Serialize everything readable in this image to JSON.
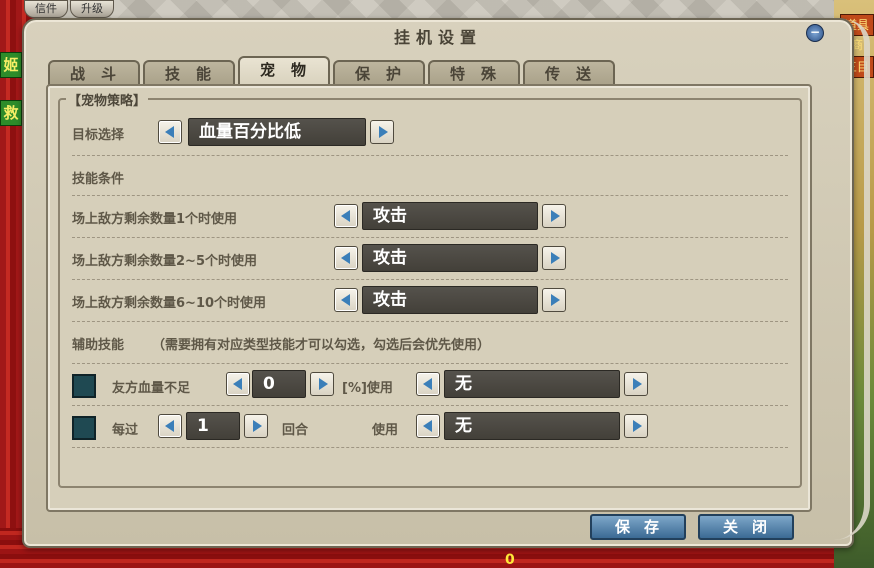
{
  "top_buttons": [
    "信件",
    "升级"
  ],
  "side_tags": [
    "姬",
    "救"
  ],
  "right_tags": [
    "道具商",
    "三目"
  ],
  "bottom_glyph": "0",
  "dialog": {
    "title": "挂机设置",
    "close_label": "−"
  },
  "tabs": [
    {
      "label": "战斗",
      "active": false
    },
    {
      "label": "技能",
      "active": false
    },
    {
      "label": "宠物",
      "active": true
    },
    {
      "label": "保护",
      "active": false
    },
    {
      "label": "特殊",
      "active": false
    },
    {
      "label": "传送",
      "active": false
    }
  ],
  "pet_strategy": {
    "legend": "【宠物策略】",
    "target_label": "目标选择",
    "target_value": "血量百分比低",
    "skill_conditions_label": "技能条件",
    "conditions": [
      {
        "label": "场上敌方剩余数量1个时使用",
        "value": "攻击"
      },
      {
        "label": "场上敌方剩余数量2~5个时使用",
        "value": "攻击"
      },
      {
        "label": "场上敌方剩余数量6~10个时使用",
        "value": "攻击"
      }
    ],
    "assist_label": "辅助技能",
    "assist_note": "（需要拥有对应类型技能才可以勾选，勾选后会优先使用）",
    "assist_hp": {
      "prefix": "友方血量不足",
      "amount": "0",
      "suffix": "[%]使用",
      "value": "无",
      "checked": false
    },
    "assist_round": {
      "prefix": "每过",
      "amount": "1",
      "unit": "回合",
      "use_label": "使用",
      "value": "无",
      "checked": false
    }
  },
  "buttons": {
    "save": "保存",
    "close": "关闭"
  },
  "colors": {
    "accent_blue": "#3b7fb9",
    "value_box": "#4a4740",
    "panel_bg": "#d6cfba",
    "checkbox": "#1f4952"
  }
}
